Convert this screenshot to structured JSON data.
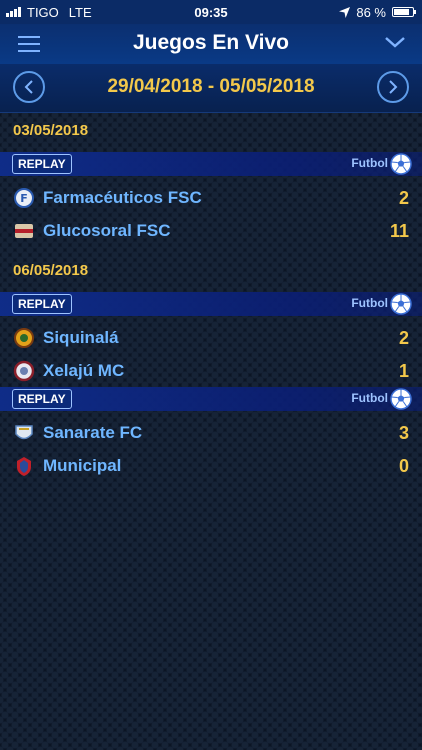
{
  "status_bar": {
    "carrier": "TIGO",
    "network": "LTE",
    "time": "09:35",
    "battery_pct": "86 %"
  },
  "nav": {
    "title": "Juegos En Vivo"
  },
  "date_range": "29/04/2018 - 05/05/2018",
  "days": [
    {
      "date": "03/05/2018",
      "games": [
        {
          "replay_label": "REPLAY",
          "sport": "Futbol",
          "teams": [
            {
              "name": "Farmacéuticos FSC",
              "score": "2"
            },
            {
              "name": "Glucosoral FSC",
              "score": "11"
            }
          ]
        }
      ]
    },
    {
      "date": "06/05/2018",
      "games": [
        {
          "replay_label": "REPLAY",
          "sport": "Futbol",
          "teams": [
            {
              "name": "Siquinalá",
              "score": "2"
            },
            {
              "name": "Xelajú MC",
              "score": "1"
            }
          ]
        },
        {
          "replay_label": "REPLAY",
          "sport": "Futbol",
          "teams": [
            {
              "name": "Sanarate FC",
              "score": "3"
            },
            {
              "name": "Municipal",
              "score": "0"
            }
          ]
        }
      ]
    }
  ],
  "colors": {
    "accent_yellow": "#f3c84b",
    "team_blue": "#6fb6ff",
    "nav_blue": "#0a3a86"
  }
}
